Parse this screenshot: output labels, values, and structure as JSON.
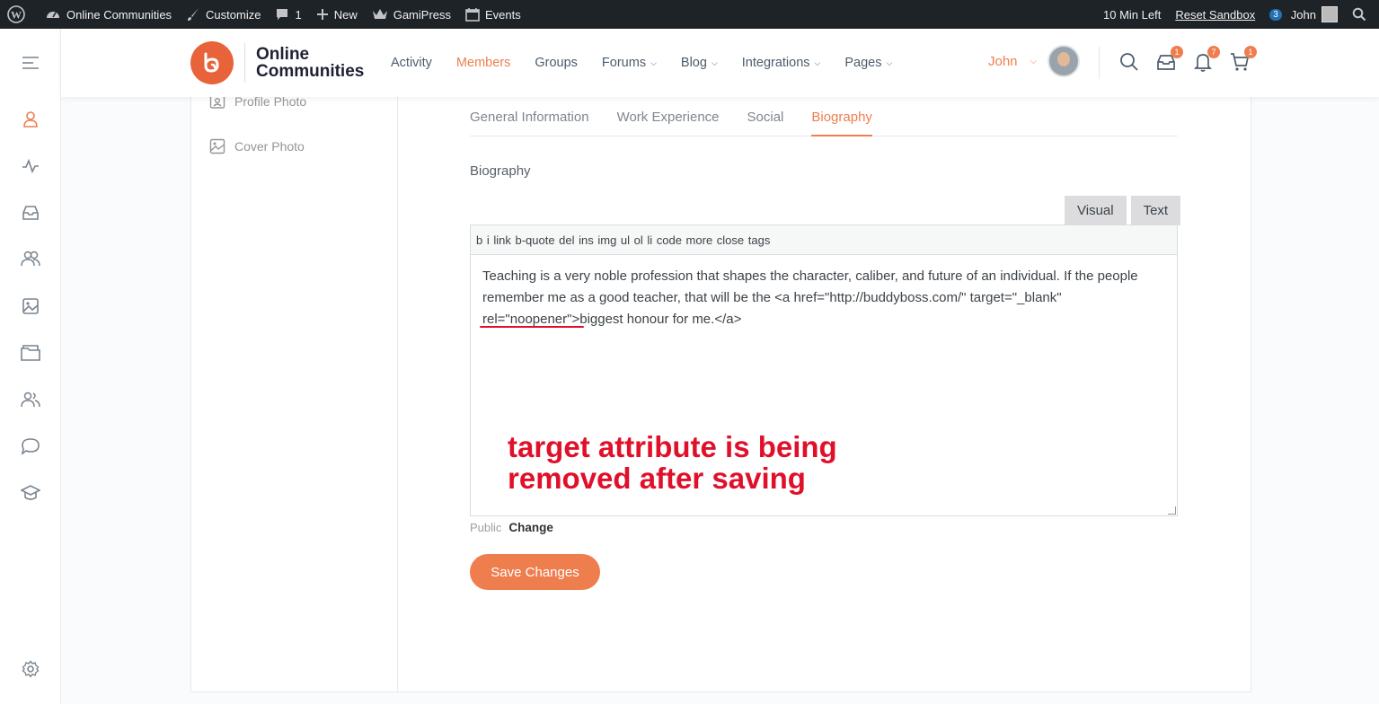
{
  "adminbar": {
    "site_name": "Online Communities",
    "customize": "Customize",
    "comments_count": "1",
    "new_label": "New",
    "gamipress": "GamiPress",
    "events": "Events",
    "time_left": "10 Min Left",
    "reset_sandbox": "Reset Sandbox",
    "badge_count": "3",
    "user_name": "John"
  },
  "header": {
    "logo_line1": "Online",
    "logo_line2": "Communities",
    "nav": [
      {
        "label": "Activity",
        "active": false,
        "dropdown": false
      },
      {
        "label": "Members",
        "active": true,
        "dropdown": false
      },
      {
        "label": "Groups",
        "active": false,
        "dropdown": false
      },
      {
        "label": "Forums",
        "active": false,
        "dropdown": true
      },
      {
        "label": "Blog",
        "active": false,
        "dropdown": true
      },
      {
        "label": "Integrations",
        "active": false,
        "dropdown": true
      },
      {
        "label": "Pages",
        "active": false,
        "dropdown": true
      }
    ],
    "user_name": "John",
    "messages_count": "1",
    "notifications_count": "7",
    "cart_count": "1",
    "caret": "⌄"
  },
  "sidebar": {
    "items": [
      {
        "label": "Profile Photo",
        "icon": "profile-photo-icon"
      },
      {
        "label": "Cover Photo",
        "icon": "cover-photo-icon"
      }
    ]
  },
  "tabs": [
    {
      "label": "General Information",
      "active": false
    },
    {
      "label": "Work Experience",
      "active": false
    },
    {
      "label": "Social",
      "active": false
    },
    {
      "label": "Biography",
      "active": true
    }
  ],
  "form": {
    "field_label": "Biography",
    "editor_tab_visual": "Visual",
    "editor_tab_text": "Text",
    "quicktags": "b i link b-quote del ins img ul ol li code more close tags",
    "textarea_value": "Teaching is a very noble profession that shapes the character, caliber, and future of an individual. If the people remember me as a good teacher, that will be the <a href=\"http://buddyboss.com/\" target=\"_blank\" rel=\"noopener\">biggest honour for me.</a>",
    "visibility_label": "Public",
    "visibility_change": "Change",
    "save_label": "Save Changes"
  },
  "annotation": {
    "line1": "target attribute is being",
    "line2": "removed after saving",
    "color": "#e0102a"
  },
  "colors": {
    "accent": "#ef7e4f",
    "adminbar": "#1d2327",
    "badge": "#2271b1"
  }
}
